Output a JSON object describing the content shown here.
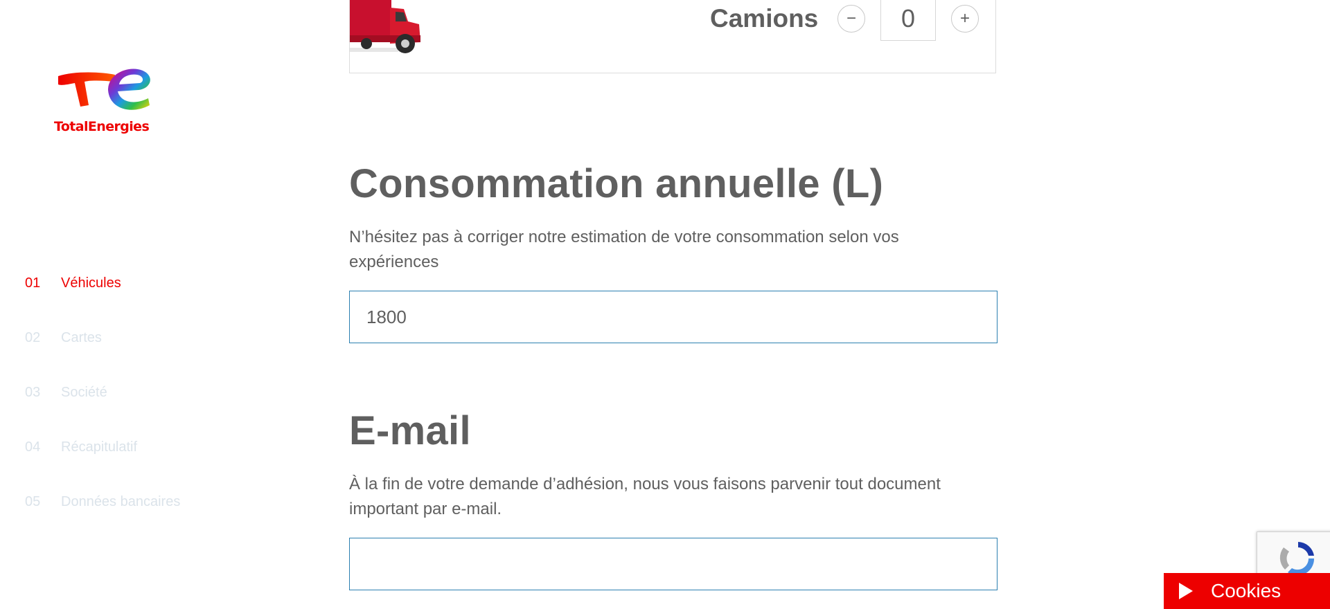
{
  "brand": {
    "name": "TotalEnergies",
    "color": "#ed0000"
  },
  "sidebar": {
    "steps": [
      {
        "num": "01",
        "label": "Véhicules",
        "active": true
      },
      {
        "num": "02",
        "label": "Cartes",
        "active": false
      },
      {
        "num": "03",
        "label": "Société",
        "active": false
      },
      {
        "num": "04",
        "label": "Récapitulatif",
        "active": false
      },
      {
        "num": "05",
        "label": "Données bancaires",
        "active": false
      }
    ]
  },
  "vehicle": {
    "label": "Camions",
    "quantity": "0",
    "minus_icon": "minus-icon",
    "plus_icon": "plus-icon",
    "minus_symbol": "−",
    "plus_symbol": "+"
  },
  "consumption": {
    "title": "Consommation annuelle (L)",
    "description": "N’hésitez pas à corriger notre estimation de votre consommation selon vos expériences",
    "value": "1800"
  },
  "email": {
    "title": "E-mail",
    "description": "À la fin de votre demande d’adhésion, nous vous faisons parvenir tout document important par e-mail.",
    "value": ""
  },
  "cookies": {
    "label": "Cookies"
  },
  "colors": {
    "accent": "#ed0000",
    "input_border": "#2b7fb0",
    "text": "#5f5f5f",
    "inactive_step": "#dbe3ea"
  }
}
